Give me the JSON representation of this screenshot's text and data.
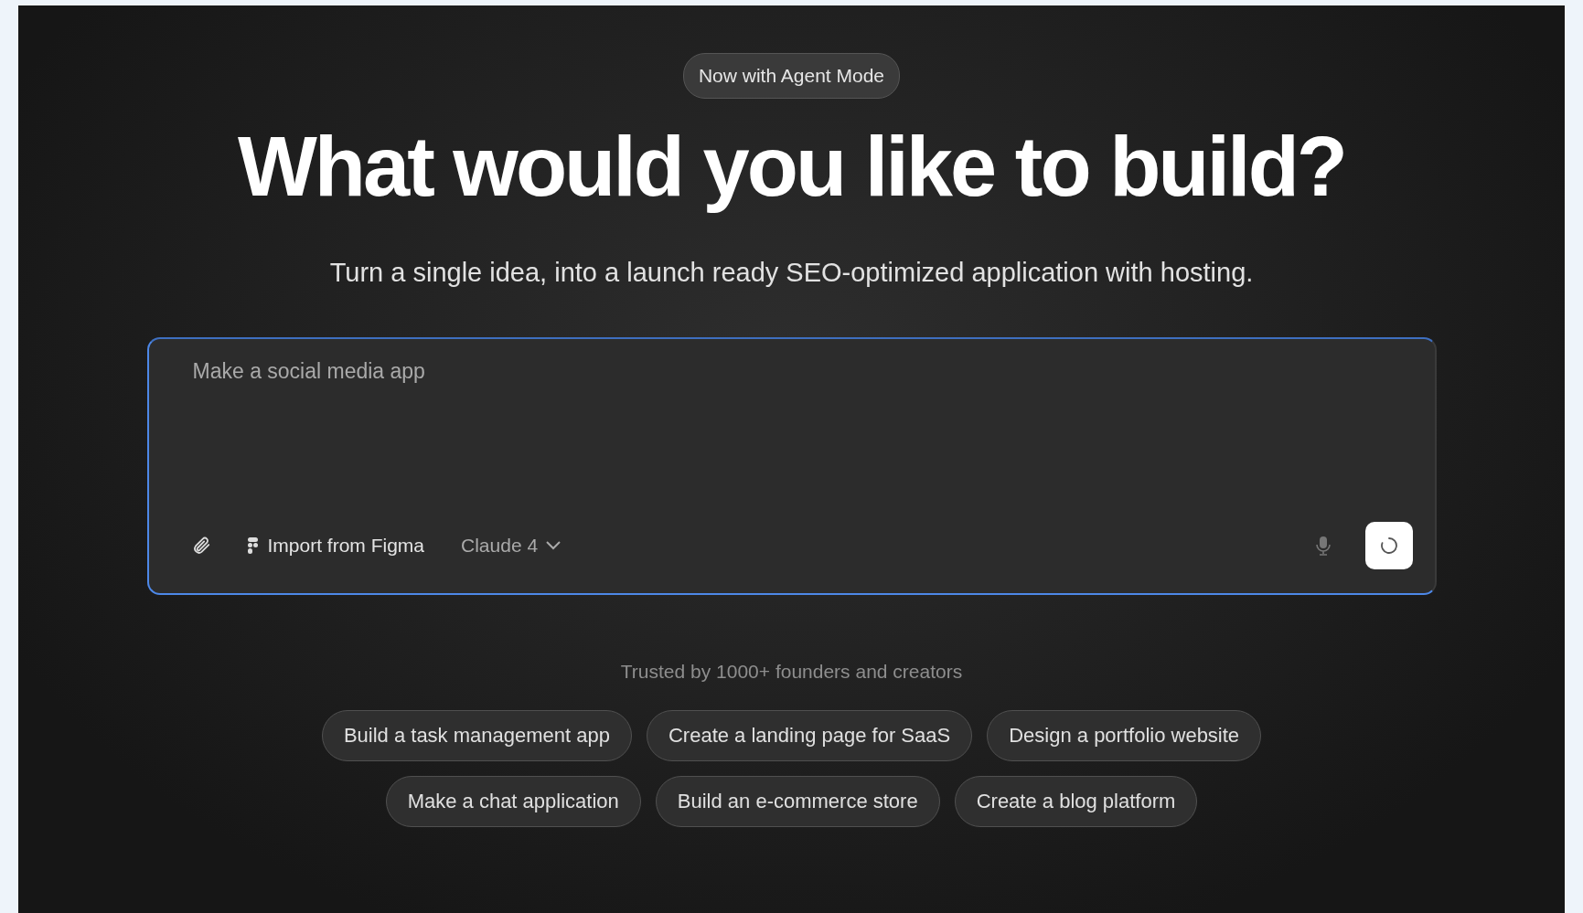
{
  "badge": "Now with Agent Mode",
  "heading": "What would you like to build?",
  "subtitle": "Turn a single idea, into a launch ready SEO-optimized application with hosting.",
  "prompt": {
    "placeholder": "Make a social media app",
    "import_button": "Import from Figma",
    "model_selector": "Claude 4"
  },
  "trusted": "Trusted by 1000+ founders and creators",
  "suggestion_rows": [
    [
      "Build a task management app",
      "Create a landing page for SaaS",
      "Design a portfolio website"
    ],
    [
      "Make a chat application",
      "Build an e-commerce store",
      "Create a blog platform"
    ]
  ]
}
